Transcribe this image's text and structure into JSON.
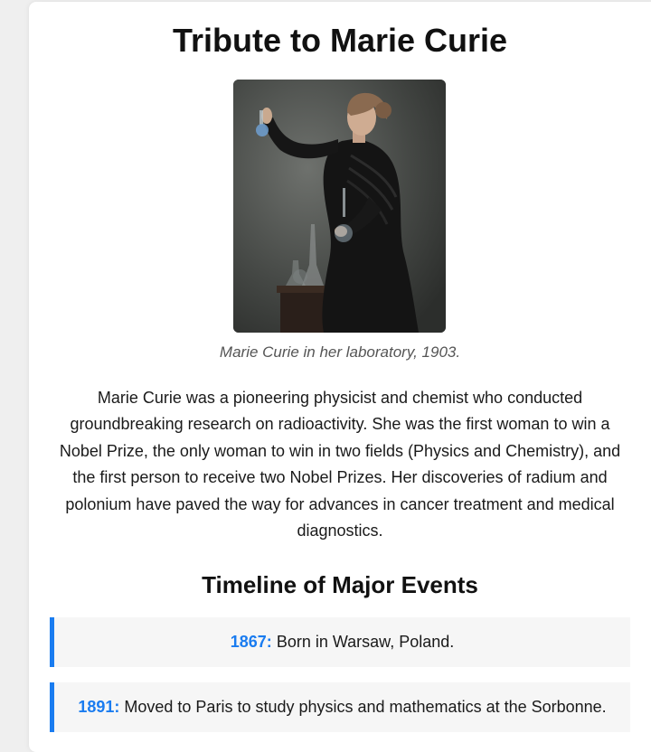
{
  "page": {
    "title": "Tribute to Marie Curie",
    "image_caption": "Marie Curie in her laboratory, 1903.",
    "bio": "Marie Curie was a pioneering physicist and chemist who conducted groundbreaking research on radioactivity. She was the first woman to win a Nobel Prize, the only woman to win in two fields (Physics and Chemistry), and the first person to receive two Nobel Prizes. Her discoveries of radium and polonium have paved the way for advances in cancer treatment and medical diagnostics."
  },
  "timeline": {
    "heading": "Timeline of Major Events",
    "events": [
      {
        "year": "1867:",
        "text": "Born in Warsaw, Poland."
      },
      {
        "year": "1891:",
        "text": "Moved to Paris to study physics and mathematics at the Sorbonne."
      }
    ]
  },
  "colors": {
    "accent": "#1a7cf0",
    "event_background": "#f6f6f6",
    "page_background": "#efefef"
  }
}
